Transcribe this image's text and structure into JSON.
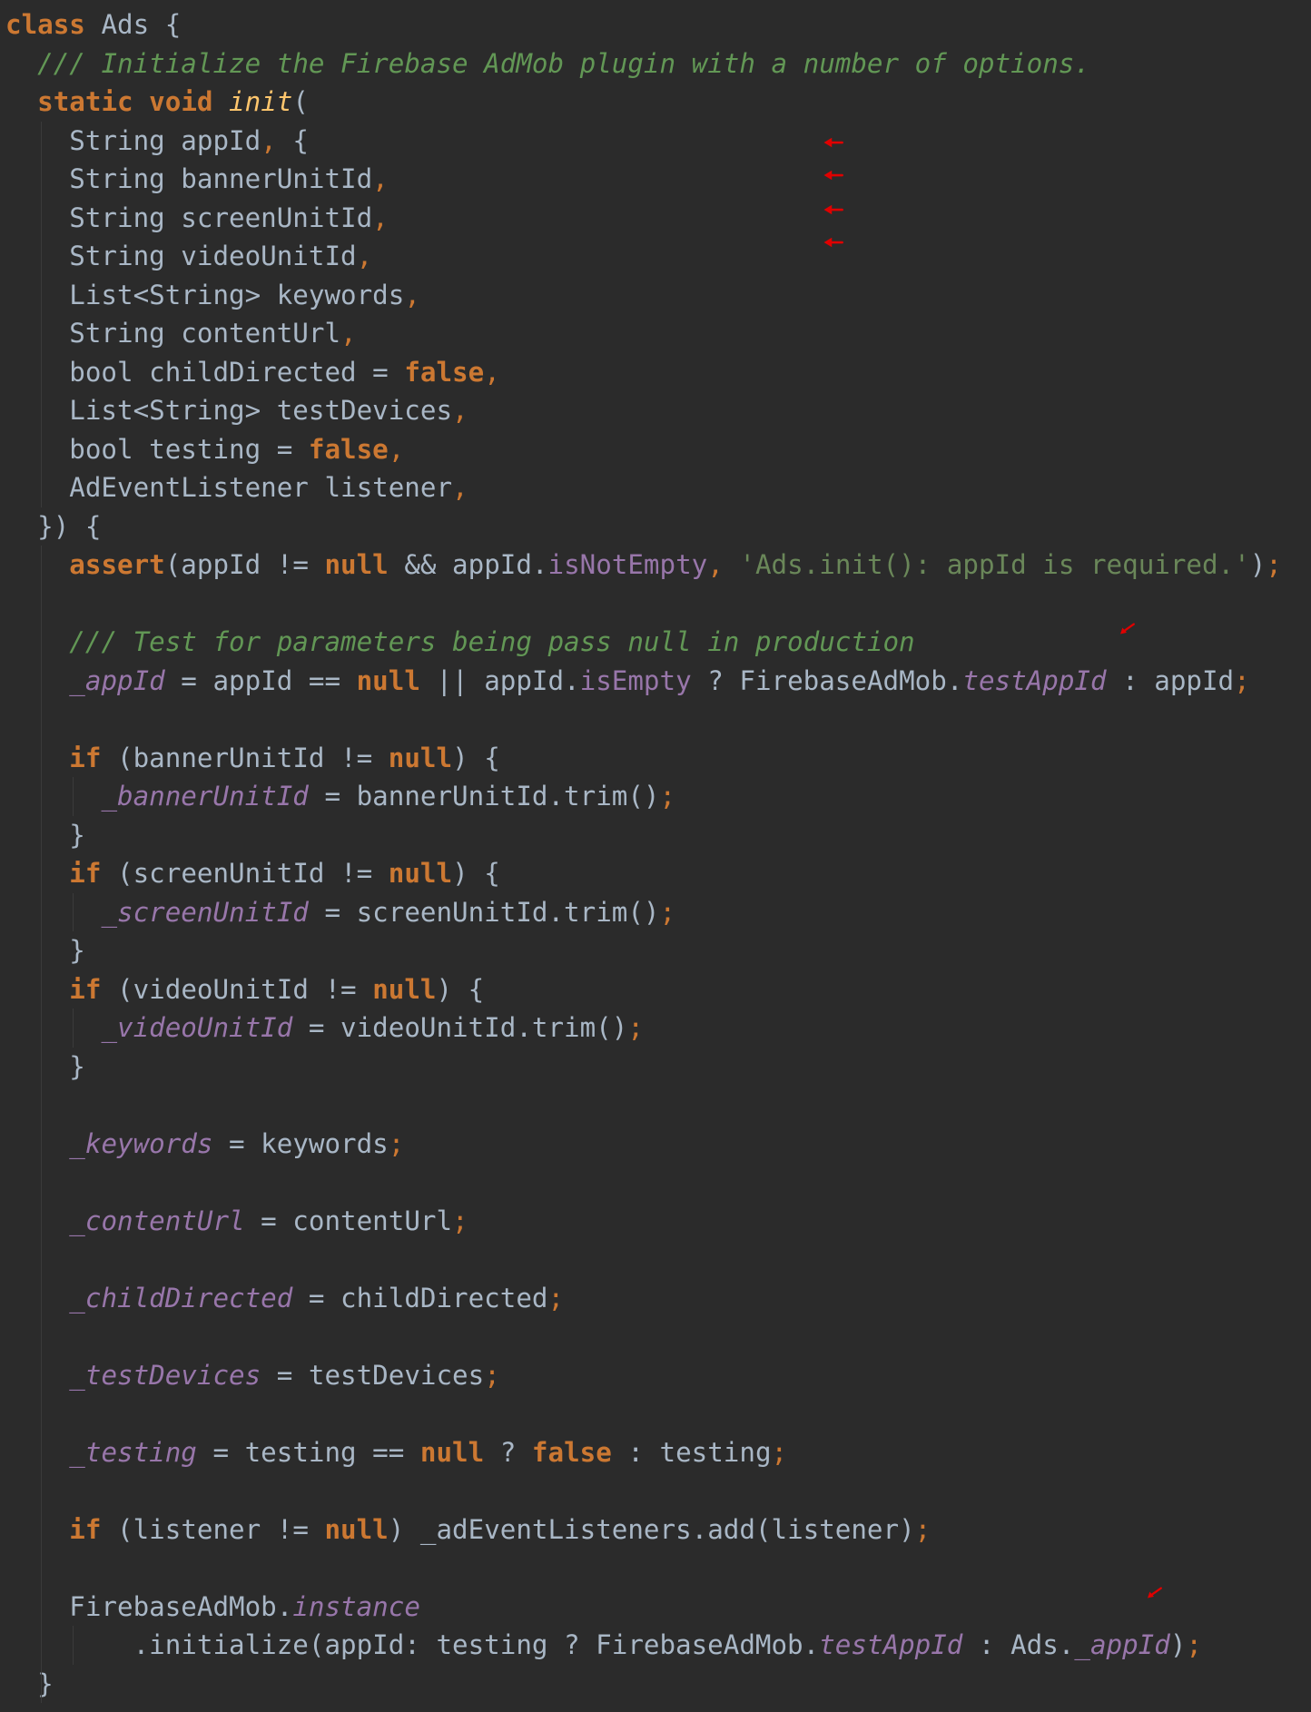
{
  "lines": [
    {
      "tokens": [
        {
          "t": "class",
          "c": "kw"
        },
        {
          "t": " Ads {",
          "c": "id"
        }
      ]
    },
    {
      "tokens": [
        {
          "t": "  ",
          "c": "id"
        },
        {
          "t": "/// Initialize the Firebase AdMob plugin with a number of options.",
          "c": "cm"
        }
      ]
    },
    {
      "tokens": [
        {
          "t": "  ",
          "c": "id"
        },
        {
          "t": "static",
          "c": "kw"
        },
        {
          "t": " ",
          "c": "id"
        },
        {
          "t": "void",
          "c": "kw"
        },
        {
          "t": " ",
          "c": "id"
        },
        {
          "t": "init",
          "c": "fn"
        },
        {
          "t": "(",
          "c": "id"
        }
      ]
    },
    {
      "tokens": [
        {
          "t": "    String appId",
          "c": "id"
        },
        {
          "t": ",",
          "c": "pn"
        },
        {
          "t": " {",
          "c": "id"
        }
      ]
    },
    {
      "tokens": [
        {
          "t": "    String bannerUnitId",
          "c": "id"
        },
        {
          "t": ",",
          "c": "pn"
        }
      ]
    },
    {
      "tokens": [
        {
          "t": "    String screenUnitId",
          "c": "id"
        },
        {
          "t": ",",
          "c": "pn"
        }
      ]
    },
    {
      "tokens": [
        {
          "t": "    String videoUnitId",
          "c": "id"
        },
        {
          "t": ",",
          "c": "pn"
        }
      ]
    },
    {
      "tokens": [
        {
          "t": "    List<String> keywords",
          "c": "id"
        },
        {
          "t": ",",
          "c": "pn"
        }
      ]
    },
    {
      "tokens": [
        {
          "t": "    String contentUrl",
          "c": "id"
        },
        {
          "t": ",",
          "c": "pn"
        }
      ]
    },
    {
      "tokens": [
        {
          "t": "    bool childDirected = ",
          "c": "id"
        },
        {
          "t": "false",
          "c": "kw"
        },
        {
          "t": ",",
          "c": "pn"
        }
      ]
    },
    {
      "tokens": [
        {
          "t": "    List<String> testDevices",
          "c": "id"
        },
        {
          "t": ",",
          "c": "pn"
        }
      ]
    },
    {
      "tokens": [
        {
          "t": "    bool testing = ",
          "c": "id"
        },
        {
          "t": "false",
          "c": "kw"
        },
        {
          "t": ",",
          "c": "pn"
        }
      ]
    },
    {
      "tokens": [
        {
          "t": "    AdEventListener listener",
          "c": "id"
        },
        {
          "t": ",",
          "c": "pn"
        }
      ]
    },
    {
      "tokens": [
        {
          "t": "  }) {",
          "c": "id"
        }
      ]
    },
    {
      "tokens": [
        {
          "t": "    ",
          "c": "id"
        },
        {
          "t": "assert",
          "c": "kw"
        },
        {
          "t": "(appId != ",
          "c": "id"
        },
        {
          "t": "null",
          "c": "kw"
        },
        {
          "t": " && appId.",
          "c": "id"
        },
        {
          "t": "isNotEmpty",
          "c": "mb"
        },
        {
          "t": ",",
          "c": "pn"
        },
        {
          "t": " ",
          "c": "id"
        },
        {
          "t": "'Ads.init(): appId is required.'",
          "c": "st"
        },
        {
          "t": ")",
          "c": "id"
        },
        {
          "t": ";",
          "c": "pn"
        }
      ]
    },
    {
      "tokens": []
    },
    {
      "tokens": [
        {
          "t": "    ",
          "c": "id"
        },
        {
          "t": "/// Test for parameters being pass null in production",
          "c": "cm"
        }
      ]
    },
    {
      "tokens": [
        {
          "t": "    ",
          "c": "id"
        },
        {
          "t": "_appId",
          "c": "fd"
        },
        {
          "t": " = appId == ",
          "c": "id"
        },
        {
          "t": "null",
          "c": "kw"
        },
        {
          "t": " || appId.",
          "c": "id"
        },
        {
          "t": "isEmpty",
          "c": "mb"
        },
        {
          "t": " ? FirebaseAdMob.",
          "c": "id"
        },
        {
          "t": "testAppId",
          "c": "fd"
        },
        {
          "t": " : appId",
          "c": "id"
        },
        {
          "t": ";",
          "c": "pn"
        }
      ]
    },
    {
      "tokens": []
    },
    {
      "tokens": [
        {
          "t": "    ",
          "c": "id"
        },
        {
          "t": "if",
          "c": "kw"
        },
        {
          "t": " (bannerUnitId != ",
          "c": "id"
        },
        {
          "t": "null",
          "c": "kw"
        },
        {
          "t": ") {",
          "c": "id"
        }
      ]
    },
    {
      "tokens": [
        {
          "t": "      ",
          "c": "id"
        },
        {
          "t": "_bannerUnitId",
          "c": "fd"
        },
        {
          "t": " = bannerUnitId.trim()",
          "c": "id"
        },
        {
          "t": ";",
          "c": "pn"
        }
      ]
    },
    {
      "tokens": [
        {
          "t": "    }",
          "c": "id"
        }
      ]
    },
    {
      "tokens": [
        {
          "t": "    ",
          "c": "id"
        },
        {
          "t": "if",
          "c": "kw"
        },
        {
          "t": " (screenUnitId != ",
          "c": "id"
        },
        {
          "t": "null",
          "c": "kw"
        },
        {
          "t": ") {",
          "c": "id"
        }
      ]
    },
    {
      "tokens": [
        {
          "t": "      ",
          "c": "id"
        },
        {
          "t": "_screenUnitId",
          "c": "fd"
        },
        {
          "t": " = screenUnitId.trim()",
          "c": "id"
        },
        {
          "t": ";",
          "c": "pn"
        }
      ]
    },
    {
      "tokens": [
        {
          "t": "    }",
          "c": "id"
        }
      ]
    },
    {
      "tokens": [
        {
          "t": "    ",
          "c": "id"
        },
        {
          "t": "if",
          "c": "kw"
        },
        {
          "t": " (videoUnitId != ",
          "c": "id"
        },
        {
          "t": "null",
          "c": "kw"
        },
        {
          "t": ") {",
          "c": "id"
        }
      ]
    },
    {
      "tokens": [
        {
          "t": "      ",
          "c": "id"
        },
        {
          "t": "_videoUnitId",
          "c": "fd"
        },
        {
          "t": " = videoUnitId.trim()",
          "c": "id"
        },
        {
          "t": ";",
          "c": "pn"
        }
      ]
    },
    {
      "tokens": [
        {
          "t": "    }",
          "c": "id"
        }
      ]
    },
    {
      "tokens": []
    },
    {
      "tokens": [
        {
          "t": "    ",
          "c": "id"
        },
        {
          "t": "_keywords",
          "c": "fd"
        },
        {
          "t": " = keywords",
          "c": "id"
        },
        {
          "t": ";",
          "c": "pn"
        }
      ]
    },
    {
      "tokens": []
    },
    {
      "tokens": [
        {
          "t": "    ",
          "c": "id"
        },
        {
          "t": "_contentUrl",
          "c": "fd"
        },
        {
          "t": " = contentUrl",
          "c": "id"
        },
        {
          "t": ";",
          "c": "pn"
        }
      ]
    },
    {
      "tokens": []
    },
    {
      "tokens": [
        {
          "t": "    ",
          "c": "id"
        },
        {
          "t": "_childDirected",
          "c": "fd"
        },
        {
          "t": " = childDirected",
          "c": "id"
        },
        {
          "t": ";",
          "c": "pn"
        }
      ]
    },
    {
      "tokens": []
    },
    {
      "tokens": [
        {
          "t": "    ",
          "c": "id"
        },
        {
          "t": "_testDevices",
          "c": "fd"
        },
        {
          "t": " = testDevices",
          "c": "id"
        },
        {
          "t": ";",
          "c": "pn"
        }
      ]
    },
    {
      "tokens": []
    },
    {
      "tokens": [
        {
          "t": "    ",
          "c": "id"
        },
        {
          "t": "_testing",
          "c": "fd"
        },
        {
          "t": " = testing == ",
          "c": "id"
        },
        {
          "t": "null",
          "c": "kw"
        },
        {
          "t": " ? ",
          "c": "id"
        },
        {
          "t": "false",
          "c": "kw"
        },
        {
          "t": " : testing",
          "c": "id"
        },
        {
          "t": ";",
          "c": "pn"
        }
      ]
    },
    {
      "tokens": []
    },
    {
      "tokens": [
        {
          "t": "    ",
          "c": "id"
        },
        {
          "t": "if",
          "c": "kw"
        },
        {
          "t": " (listener != ",
          "c": "id"
        },
        {
          "t": "null",
          "c": "kw"
        },
        {
          "t": ") _adEventListeners.add(listener)",
          "c": "id"
        },
        {
          "t": ";",
          "c": "pn"
        }
      ]
    },
    {
      "tokens": []
    },
    {
      "tokens": [
        {
          "t": "    FirebaseAdMob.",
          "c": "id"
        },
        {
          "t": "instance",
          "c": "fd"
        }
      ]
    },
    {
      "tokens": [
        {
          "t": "        .initialize(appId: testing ? FirebaseAdMob.",
          "c": "id"
        },
        {
          "t": "testAppId",
          "c": "fd"
        },
        {
          "t": " : Ads.",
          "c": "id"
        },
        {
          "t": "_appId",
          "c": "fd"
        },
        {
          "t": ")",
          "c": "id"
        },
        {
          "t": ";",
          "c": "pn"
        }
      ]
    },
    {
      "tokens": [
        {
          "t": "  }",
          "c": "id"
        }
      ]
    }
  ],
  "colors": {
    "background": "#2b2b2b",
    "keyword": "#cc7832",
    "identifier": "#a9b7c6",
    "comment": "#629755",
    "string": "#6a8759",
    "field": "#9876aa",
    "function": "#ffc66d",
    "annotation_arrow": "#e00000"
  },
  "annotations": [
    {
      "name": "red-arrow-icon",
      "direction": "left",
      "line": 3
    },
    {
      "name": "red-arrow-icon",
      "direction": "left",
      "line": 4
    },
    {
      "name": "red-arrow-icon",
      "direction": "left",
      "line": 5
    },
    {
      "name": "red-arrow-icon",
      "direction": "left",
      "line": 6
    },
    {
      "name": "red-arrow-icon",
      "direction": "down-left",
      "line": 16
    },
    {
      "name": "red-arrow-icon",
      "direction": "down-left",
      "line": 41
    }
  ]
}
